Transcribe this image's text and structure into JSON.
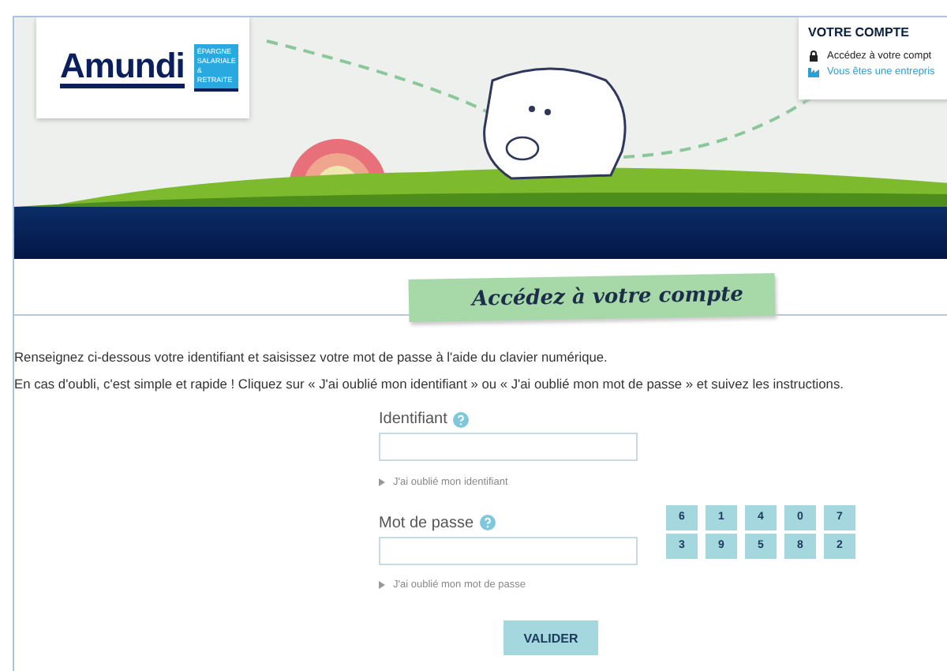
{
  "header": {
    "logo": "Amundi",
    "logo_tagline": "ÉPARGNE SALARIALE & RETRAITE",
    "account_box": {
      "title": "VOTRE COMPTE",
      "links": [
        {
          "label": "Accédez à votre compt",
          "kind": "lock"
        },
        {
          "label": "Vous êtes une entrepris",
          "kind": "building"
        }
      ]
    }
  },
  "page_title": "Accédez à votre compte",
  "intro": [
    "Renseignez ci-dessous votre identifiant et saisissez votre mot de passe à l'aide du clavier numérique.",
    "En cas d'oubli, c'est simple et rapide ! Cliquez sur « J'ai oublié mon identifiant » ou « J'ai oublié mon mot de passe » et suivez les instructions."
  ],
  "fields": [
    {
      "label": "Identifiant",
      "forgot_link": "J'ai oublié mon identifiant",
      "keypad": false
    },
    {
      "label": "Mot de passe",
      "forgot_link": "J'ai oublié mon mot de passe",
      "keypad": true
    }
  ],
  "keypad": [
    [
      "6",
      "1",
      "4",
      "0",
      "7"
    ],
    [
      "3",
      "9",
      "5",
      "8",
      "2"
    ]
  ],
  "submit_button": "VALIDER"
}
